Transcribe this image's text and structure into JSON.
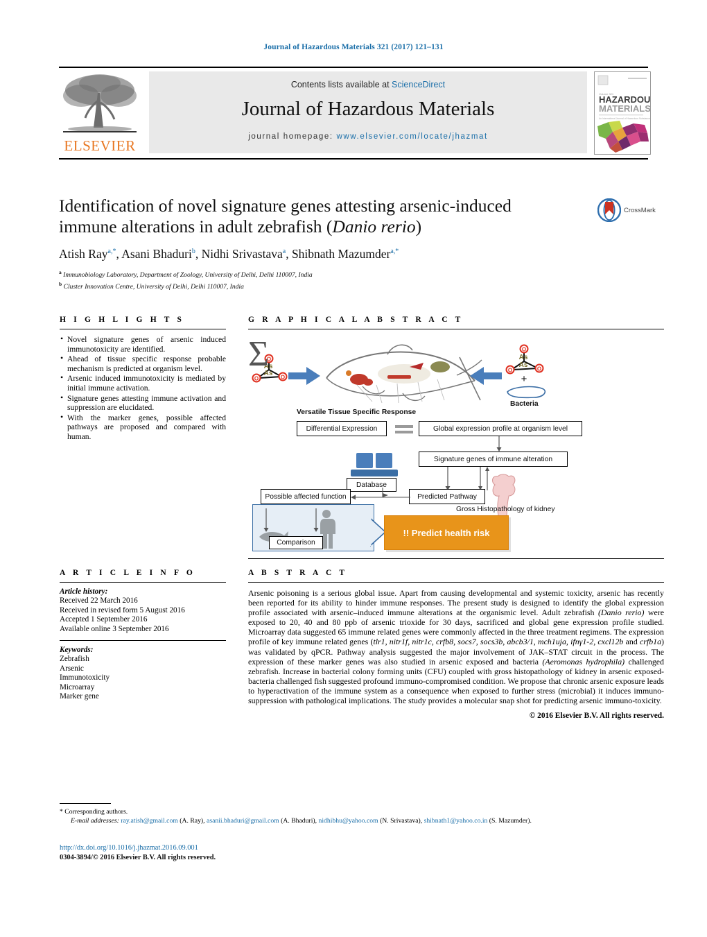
{
  "running_head": "Journal of Hazardous Materials 321 (2017) 121–131",
  "masthead": {
    "contents_prefix": "Contents lists available at ",
    "sciencedirect": "ScienceDirect",
    "journal_title": "Journal of Hazardous Materials",
    "homepage_label": "journal homepage: ",
    "homepage_url": "www.elsevier.com/locate/jhazmat",
    "publisher": "ELSEVIER",
    "cover_line1": "HAZARDOUS",
    "cover_line2": "MATERIALS",
    "link_color": "#1a6ea8",
    "elsevier_orange": "#E87722"
  },
  "article": {
    "title_line1": "Identification of novel signature genes attesting arsenic-induced",
    "title_line2_pre": "immune alterations in adult zebrafish (",
    "title_species": "Danio rerio",
    "title_line2_post": ")",
    "authors": [
      {
        "name": "Atish Ray",
        "sup": "a,*"
      },
      {
        "name": "Asani Bhaduri",
        "sup": "b"
      },
      {
        "name": "Nidhi Srivastava",
        "sup": "a"
      },
      {
        "name": "Shibnath Mazumder",
        "sup": "a,*"
      }
    ],
    "affiliations": [
      {
        "marker": "a",
        "text": "Immunobiology Laboratory, Department of Zoology, University of Delhi, Delhi 110007, India"
      },
      {
        "marker": "b",
        "text": "Cluster Innovation Centre, University of Delhi, Delhi 110007, India"
      }
    ],
    "crossmark_label": "CrossMark"
  },
  "highlights": {
    "heading": "H I G H L I G H T S",
    "items": [
      "Novel signature genes of arsenic induced immunotoxicity are identified.",
      "Ahead of tissue specific response probable mechanism is predicted at organism level.",
      "Arsenic induced immunotoxicity is mediated by initial immune activation.",
      "Signature genes attesting immune activation and suppression are elucidated.",
      "With the marker genes, possible affected pathways are proposed and compared with human."
    ]
  },
  "graphical_abstract": {
    "heading": "G R A P H I C A L   A B S T R A C T",
    "arsenic_label_as": "As",
    "arsenic_label_o": "O",
    "plus": "+",
    "bacteria_label": "Bacteria",
    "versatile_label": "Versatile Tissue Specific Response",
    "boxes": [
      {
        "id": "differential-expression",
        "label": "Differential Expression"
      },
      {
        "id": "global-expression",
        "label": "Global expression profile at organism level"
      },
      {
        "id": "signature-genes",
        "label": "Signature genes of immune alteration"
      },
      {
        "id": "database",
        "label": "Database"
      },
      {
        "id": "predicted-pathway",
        "label": "Predicted Pathway"
      },
      {
        "id": "possible-affected-function",
        "label": "Possible affected function"
      },
      {
        "id": "comparison",
        "label": "Comparison"
      }
    ],
    "histopathology_label": "Gross Histopathology of kidney",
    "predict_button": "!! Predict health risk",
    "accent_blue": "#3b6ea5",
    "accent_orange": "#E8941A"
  },
  "article_info": {
    "heading": "A R T I C L E   I N F O",
    "history_label": "Article history:",
    "history": [
      "Received 22 March 2016",
      "Received in revised form 5 August 2016",
      "Accepted 1 September 2016",
      "Available online 3 September 2016"
    ],
    "keywords_label": "Keywords:",
    "keywords": [
      "Zebrafish",
      "Arsenic",
      "Immunotoxicity",
      "Microarray",
      "Marker gene"
    ]
  },
  "abstract": {
    "heading": "A B S T R A C T",
    "paragraph_1": "Arsenic poisoning is a serious global issue. Apart from causing developmental and systemic toxicity, arsenic has recently been reported for its ability to hinder immune responses. The present study is designed to identify the global expression profile associated with arsenic–induced immune alterations at the organismic level. Adult zebrafish ",
    "species_1": "(Danio rerio)",
    "paragraph_2": " were exposed to 20, 40 and 80 ppb of arsenic trioxide for 30 days, sacrificed and global gene expression profile studied. Microarray data suggested 65 immune related genes were commonly affected in the three treatment regimens. The expression profile of key immune related genes (",
    "genes": "tlr1, nitr1f, nitr1c, crfb8, socs7, socs3b, abcb3/1, mch1uja, ifnγ1-2, cxcl12b",
    "genes_tail": " and ",
    "genes_last": "crfb1a",
    "paragraph_3": ") was validated by qPCR. Pathway analysis suggested the major involvement of JAK–STAT circuit in the process. The expression of these marker genes was also studied in arsenic exposed and bacteria ",
    "species_2": "(Aeromonas hydrophila)",
    "paragraph_4": " challenged zebrafish. Increase in bacterial colony forming units (CFU) coupled with gross histopathology of kidney in arsenic exposed-bacteria challenged fish suggested profound immuno-compromised condition. We propose that chronic arsenic exposure leads to hyperactivation of the immune system as a consequence when exposed to further stress (microbial) it induces immuno-suppression with pathological implications. The study provides a molecular snap shot for predicting arsenic immuno-toxicity.",
    "copyright": "© 2016 Elsevier B.V. All rights reserved."
  },
  "footer": {
    "corresponding_marker": "*",
    "corresponding_label": "Corresponding authors.",
    "email_label": "E-mail addresses:",
    "emails": [
      {
        "address": "ray.atish@gmail.com",
        "owner": "(A. Ray),"
      },
      {
        "address": "asanii.bhaduri@gmail.com",
        "owner": "(A. Bhaduri),"
      },
      {
        "address": "nidhibhu@yahoo.com",
        "owner": "(N. Srivastava),"
      },
      {
        "address": "shibnath1@yahoo.co.in",
        "owner": "(S. Mazumder)."
      }
    ],
    "doi": "http://dx.doi.org/10.1016/j.jhazmat.2016.09.001",
    "issn_line": "0304-3894/© 2016 Elsevier B.V. All rights reserved."
  }
}
